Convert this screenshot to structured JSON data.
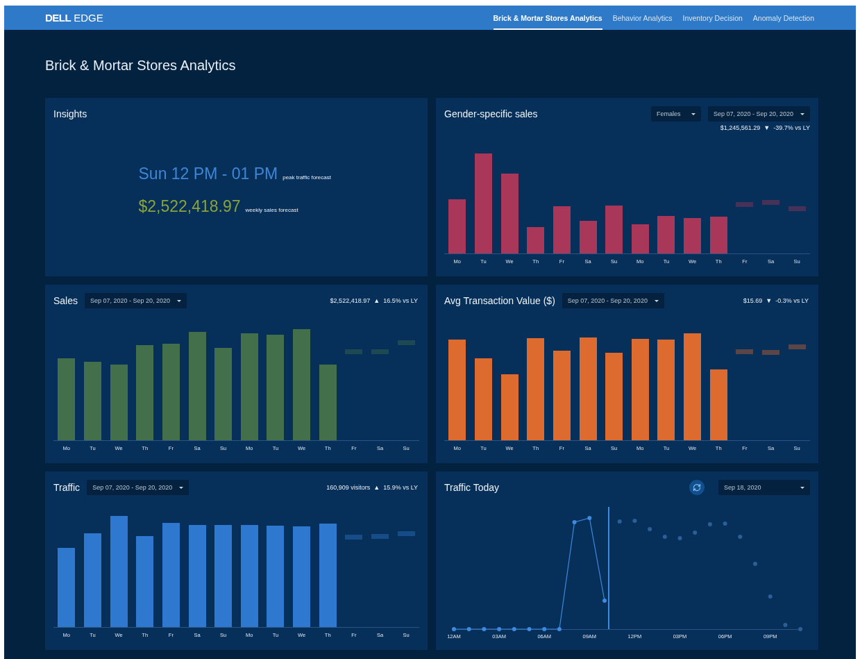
{
  "header": {
    "logo": "DELL",
    "product": "EDGE"
  },
  "nav": [
    {
      "label": "Brick & Mortar Stores Analytics",
      "selected": true
    },
    {
      "label": "Behavior Analytics",
      "selected": false
    },
    {
      "label": "Inventory Decision",
      "selected": false
    },
    {
      "label": "Anomaly Detection",
      "selected": false
    }
  ],
  "page_title": "Brick & Mortar Stores Analytics",
  "cards": [
    {
      "kind": "insights",
      "title": "Insights",
      "forecasts": [
        {
          "kind": "traffic",
          "value": "Sun 12 PM - 01 PM",
          "label": "peak traffic forecast"
        },
        {
          "kind": "sales",
          "value": "$2,522,418.97",
          "label": "weekly sales forecast"
        }
      ]
    },
    {
      "kind": "bars",
      "title": "Gender-specific sales",
      "summary_below": true,
      "color": "#a8375a",
      "filters": [
        "Females",
        "Sep 07, 2020 - Sep 20, 2020"
      ],
      "summary": {
        "total": "$1,245,561.29",
        "arrow": "▼",
        "change": "-39.7% vs LY"
      },
      "x_labels": [
        "Mo",
        "Tu",
        "We",
        "Th",
        "Fr",
        "Sa",
        "Su",
        "Mo",
        "Tu",
        "We",
        "Th",
        "Fr",
        "Sa",
        "Su"
      ]
    },
    {
      "kind": "bars",
      "title": "Sales",
      "summary_below": false,
      "color": "#43704a",
      "filters": [
        "Sep 07, 2020 - Sep 20, 2020"
      ],
      "summary": {
        "total": "$2,522,418.97",
        "arrow": "▲",
        "change": "16.5% vs LY"
      },
      "x_labels": [
        "Mo",
        "Tu",
        "We",
        "Th",
        "Fr",
        "Sa",
        "Su",
        "Mo",
        "Tu",
        "We",
        "Th",
        "Fr",
        "Sa",
        "Su"
      ]
    },
    {
      "kind": "bars",
      "title": "Avg Transaction Value ($)",
      "summary_below": false,
      "color": "#dd6a2e",
      "filters": [
        "Sep 07, 2020 - Sep 20, 2020"
      ],
      "summary": {
        "total": "$15.69",
        "arrow": "▼",
        "change": "-0.3% vs LY"
      },
      "x_labels": [
        "Mo",
        "Tu",
        "We",
        "Th",
        "Fr",
        "Sa",
        "Su",
        "Mo",
        "Tu",
        "We",
        "Th",
        "Fr",
        "Sa",
        "Su"
      ]
    },
    {
      "kind": "bars",
      "title": "Traffic",
      "summary_below": false,
      "color": "#2f78d0",
      "filters": [
        "Sep 07, 2020 - Sep 20, 2020"
      ],
      "summary": {
        "total": "160,909 visitors",
        "arrow": "▲",
        "change": "15.9% vs LY"
      },
      "x_labels": [
        "Mo",
        "Tu",
        "We",
        "Th",
        "Fr",
        "Sa",
        "Su",
        "Mo",
        "Tu",
        "We",
        "Th",
        "Fr",
        "Sa",
        "Su"
      ]
    },
    {
      "kind": "line",
      "title": "Traffic Today",
      "filters": [
        "Sep 18, 2020"
      ],
      "x_ticks": [
        "12AM",
        "03AM",
        "06AM",
        "09AM",
        "12PM",
        "03PM",
        "06PM",
        "09PM"
      ]
    }
  ]
}
